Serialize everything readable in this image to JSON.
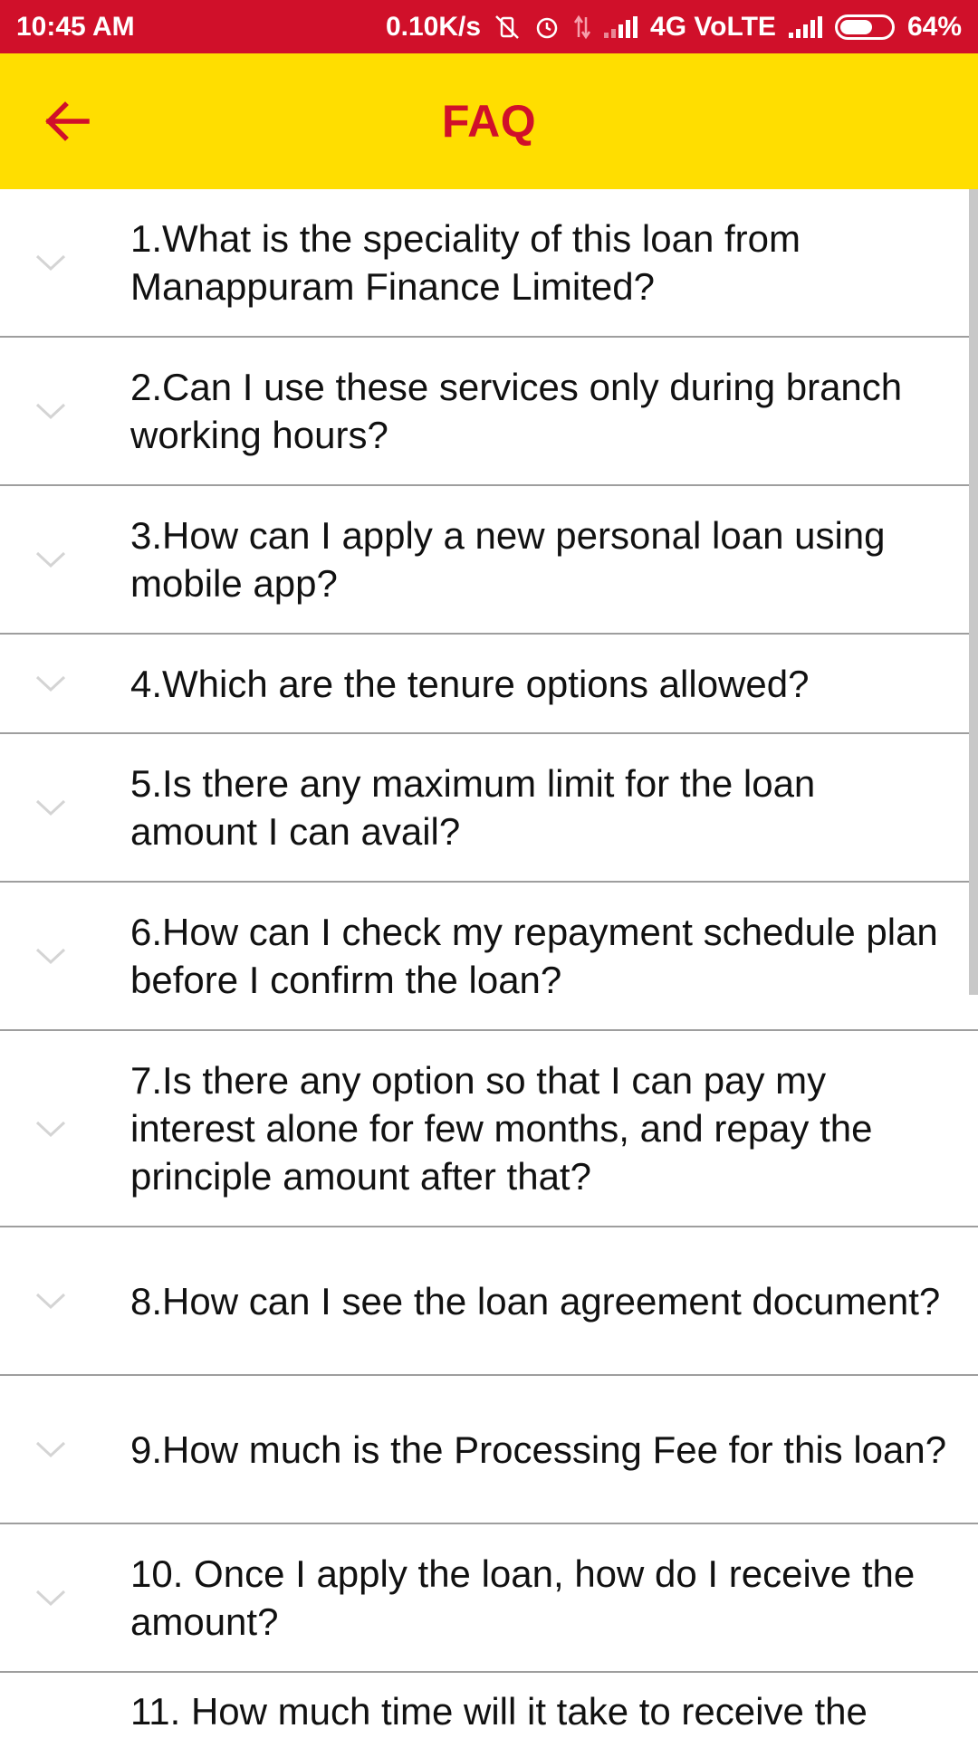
{
  "status_bar": {
    "time": "10:45 AM",
    "network_speed": "0.10K/s",
    "network_type": "4G VoLTE",
    "battery_percent": "64%",
    "battery_level": 0.64,
    "icons": [
      "vibrate-off-icon",
      "alarm-icon",
      "data-arrows-icon",
      "signal-icon",
      "signal-icon",
      "battery-icon"
    ]
  },
  "app_bar": {
    "title": "FAQ",
    "back_icon": "arrow-back-icon",
    "background": "#ffde00",
    "accent": "#d0102a"
  },
  "faq": {
    "items": [
      {
        "question": "1.What is the speciality of this loan from Manappuram Finance Limited?"
      },
      {
        "question": "2.Can I use these services only during branch working hours?"
      },
      {
        "question": "3.How can I apply a new personal loan using mobile app?"
      },
      {
        "question": "4.Which are the tenure options allowed?"
      },
      {
        "question": "5.Is there any maximum limit for the loan amount I can avail?"
      },
      {
        "question": "6.How can I check my repayment schedule plan before I confirm the loan?"
      },
      {
        "question": "7.Is there any option so that I can pay my interest alone for few months, and repay the principle amount after that?"
      },
      {
        "question": "8.How can I see the loan agreement document?"
      },
      {
        "question": "9.How much is the Processing Fee for this loan?"
      },
      {
        "question": "10.  Once I apply the loan, how do I receive the amount?"
      },
      {
        "question": "11.  How much time will it take to receive the"
      }
    ],
    "expand_icon": "chevron-down-icon"
  }
}
